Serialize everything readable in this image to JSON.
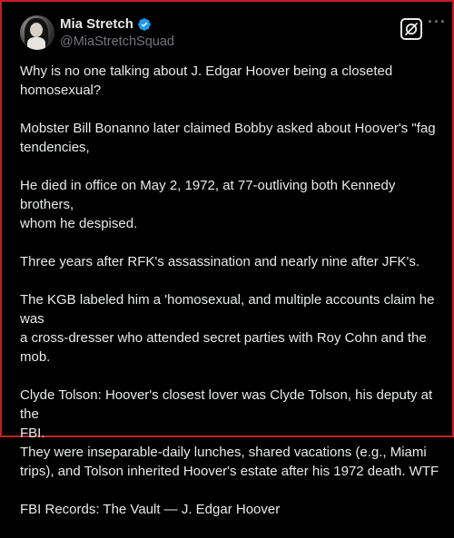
{
  "author": {
    "display_name": "Mia Stretch",
    "handle": "@MiaStretchSquad"
  },
  "icons": {
    "verified": "verified-badge-icon",
    "grok": "grok-icon",
    "more": "more-options-icon"
  },
  "colors": {
    "verified_blue": "#1d9bf0",
    "text": "#e7e9ea",
    "muted": "#71767b",
    "frame_border": "#c41e25"
  },
  "post": {
    "paragraphs": [
      {
        "lines": [
          "Why is no one talking about J. Edgar Hoover being a closeted",
          "homosexual?"
        ]
      },
      {
        "lines": [
          "Mobster Bill Bonanno later claimed Bobby asked about Hoover's \"fag",
          "tendencies,"
        ]
      },
      {
        "lines": [
          "He died in office on May 2, 1972, at 77-outliving both Kennedy brothers,",
          "whom he despised."
        ]
      },
      {
        "lines": [
          "Three years after RFK's assassination and nearly nine after JFK's."
        ]
      },
      {
        "lines": [
          "The KGB labeled him a 'homosexual, and multiple accounts claim he was",
          "a cross-dresser who attended secret parties with Roy Cohn and the",
          "mob."
        ]
      },
      {
        "lines": [
          "Clyde Tolson: Hoover's closest lover was Clyde Tolson, his deputy at the",
          "FBI.",
          "They were inseparable-daily lunches, shared vacations (e.g., Miami",
          "trips), and Tolson inherited Hoover's estate after his 1972 death. WTF"
        ]
      },
      {
        "lines": [
          "FBI Records: The Vault — J. Edgar Hoover"
        ]
      }
    ]
  }
}
